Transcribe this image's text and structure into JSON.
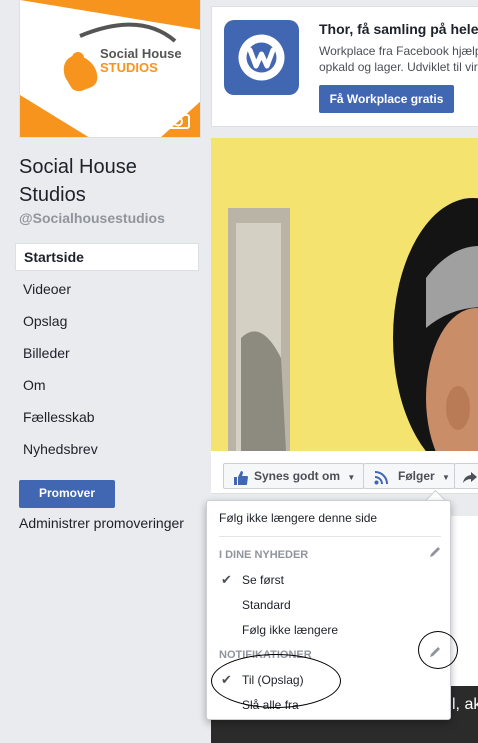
{
  "sidebar": {
    "logo": {
      "line1": "Social House",
      "line2": "STUDIOS",
      "accent": "#f7941d"
    },
    "page_name": "Social House Studios",
    "username": "@Socialhousestudios",
    "nav": [
      "Startside",
      "Videoer",
      "Opslag",
      "Billeder",
      "Om",
      "Fællesskab",
      "Nyhedsbrev"
    ],
    "active_nav": "Startside",
    "promote_label": "Promover",
    "manage_promotions": "Administrer promoveringer"
  },
  "ad": {
    "title": "Thor, få samling på hele",
    "desc_line1": "Workplace fra Facebook hjælp",
    "desc_line2": "opkald og lager. Udviklet til vir",
    "button": "Få Workplace gratis"
  },
  "actions": {
    "like": "Synes godt om",
    "follow": "Følger"
  },
  "dropdown": {
    "top_item": "Følg ikke længere denne side",
    "section_news": "I DINE NYHEDER",
    "news_options": [
      "Se først",
      "Standard",
      "Følg ikke længere"
    ],
    "news_selected": "Se først",
    "section_notifications": "NOTIFIKATIONER",
    "notification_options": [
      "Til (Opslag)",
      "Slå alle fra"
    ],
    "notification_selected": "Til (Opslag)"
  },
  "video_caption": "l, ak",
  "colors": {
    "facebook_blue": "#4267b2",
    "cover_yellow": "#f4e36f"
  }
}
